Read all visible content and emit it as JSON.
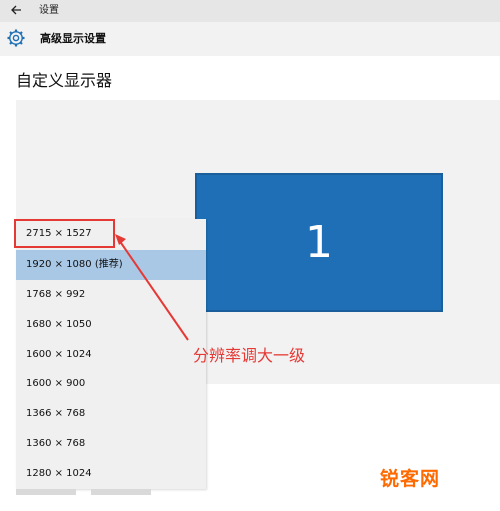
{
  "window": {
    "title": "设置"
  },
  "header": {
    "title": "高级显示设置"
  },
  "section": {
    "title": "自定义显示器"
  },
  "monitor": {
    "number": "1",
    "color": "#1e6fb5"
  },
  "resolution_dropdown": {
    "items": [
      "2715 × 1527",
      "1920 × 1080 (推荐)",
      "1768 × 992",
      "1680 × 1050",
      "1600 × 1024",
      "1600 × 900",
      "1366 × 768",
      "1360 × 768",
      "1280 × 1024"
    ],
    "selected_index": 1
  },
  "annotation": {
    "text": "分辨率调大一级",
    "color": "#e53935"
  },
  "watermark": {
    "text": "锐客网"
  },
  "icons": {
    "back": "back-arrow-icon",
    "settings": "gear-icon"
  }
}
